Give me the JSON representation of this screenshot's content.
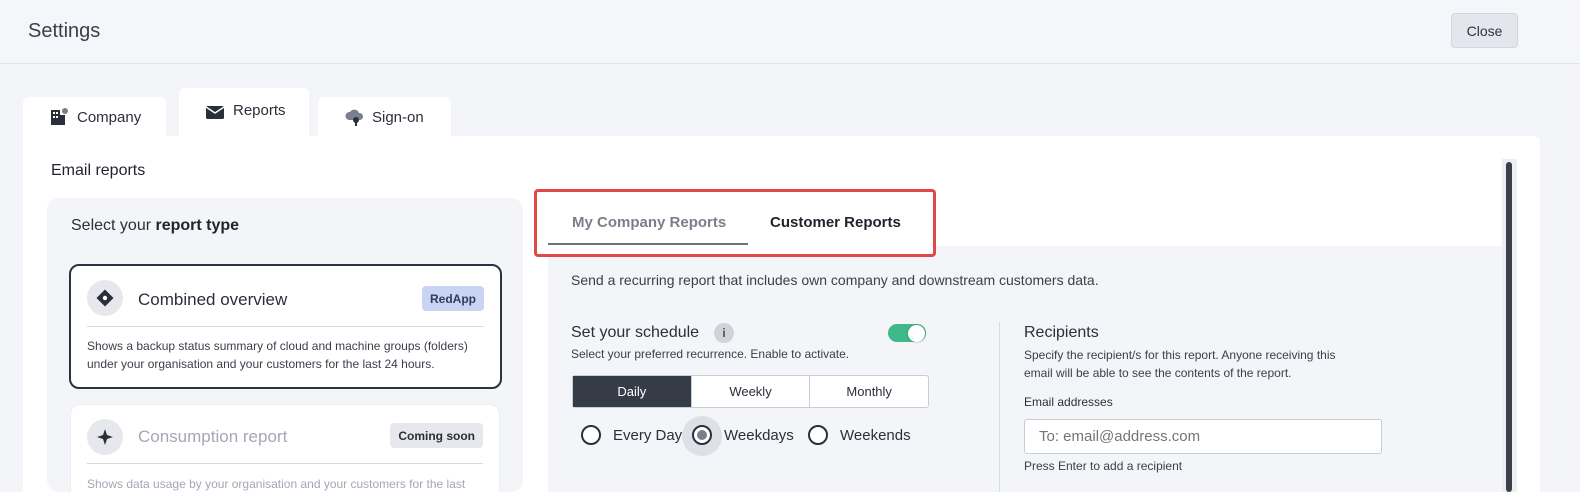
{
  "header": {
    "title": "Settings",
    "close_label": "Close"
  },
  "tabs": [
    {
      "label": "Company",
      "icon": "building-icon"
    },
    {
      "label": "Reports",
      "icon": "envelope-icon"
    },
    {
      "label": "Sign-on",
      "icon": "cloud-key-icon"
    }
  ],
  "panel": {
    "title": "Email reports"
  },
  "report_type": {
    "heading_prefix": "Select your ",
    "heading_bold": "report type",
    "options": [
      {
        "name": "Combined overview",
        "badge": "RedApp",
        "description": "Shows a backup status summary of cloud and machine groups (folders) under your organisation and your customers for the last 24 hours.",
        "selected": true
      },
      {
        "name": "Consumption report",
        "badge": "Coming soon",
        "description": "Shows data usage by your organisation and your customers for the last",
        "selected": false
      }
    ]
  },
  "subtabs": [
    {
      "label": "My Company Reports",
      "active": true
    },
    {
      "label": "Customer Reports",
      "active": false
    }
  ],
  "content": {
    "lead": "Send a recurring report that includes own company and downstream customers data."
  },
  "schedule": {
    "title": "Set your schedule",
    "info": "i",
    "subtitle": "Select your preferred recurrence. Enable to activate.",
    "enabled": true,
    "segments": [
      "Daily",
      "Weekly",
      "Monthly"
    ],
    "active_segment": "Daily",
    "radio_options": [
      "Every Day",
      "Weekdays",
      "Weekends"
    ],
    "selected_radio": "Weekdays"
  },
  "recipients": {
    "title": "Recipients",
    "subtitle": "Specify the recipient/s for this report. Anyone receiving this email will be able to see the contents of the report.",
    "email_label": "Email addresses",
    "email_placeholder": "To: email@address.com",
    "hint": "Press Enter to add a recipient"
  },
  "colors": {
    "accent_toggle": "#3fb98a",
    "highlight_border": "#e04848",
    "active_segment": "#363b48",
    "badge_redapp": "#c9d3f4"
  }
}
